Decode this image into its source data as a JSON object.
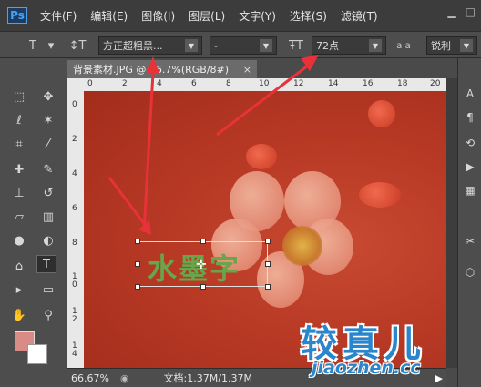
{
  "app": {
    "logo": "Ps"
  },
  "menu": [
    "文件(F)",
    "编辑(E)",
    "图像(I)",
    "图层(L)",
    "文字(Y)",
    "选择(S)",
    "滤镜(T)"
  ],
  "options": {
    "font_family": "方正超粗黑...",
    "font_style": "-",
    "font_size": "72点",
    "antialias_icon_text": "a a",
    "antialias": "锐利"
  },
  "document": {
    "tab_title": "背景素材.JPG @ 66.7%(RGB/8#)",
    "close": "×",
    "canvas_text": "水墨字"
  },
  "ruler_top": [
    "0",
    "2",
    "4",
    "6",
    "8",
    "10",
    "12",
    "14",
    "16",
    "18",
    "20"
  ],
  "ruler_left": [
    "0",
    "2",
    "4",
    "6",
    "8",
    "1 0",
    "1 2",
    "1 4"
  ],
  "status": {
    "zoom": "66.67%",
    "doc_info": "文档:1.37M/1.37M"
  },
  "watermark": {
    "cn": "较真儿",
    "en": "jiaozhen.cc"
  },
  "colors": {
    "foreground": "#d98b86",
    "background": "#ffffff",
    "canvas": "#b83a25",
    "arrow": "#e8323a"
  }
}
